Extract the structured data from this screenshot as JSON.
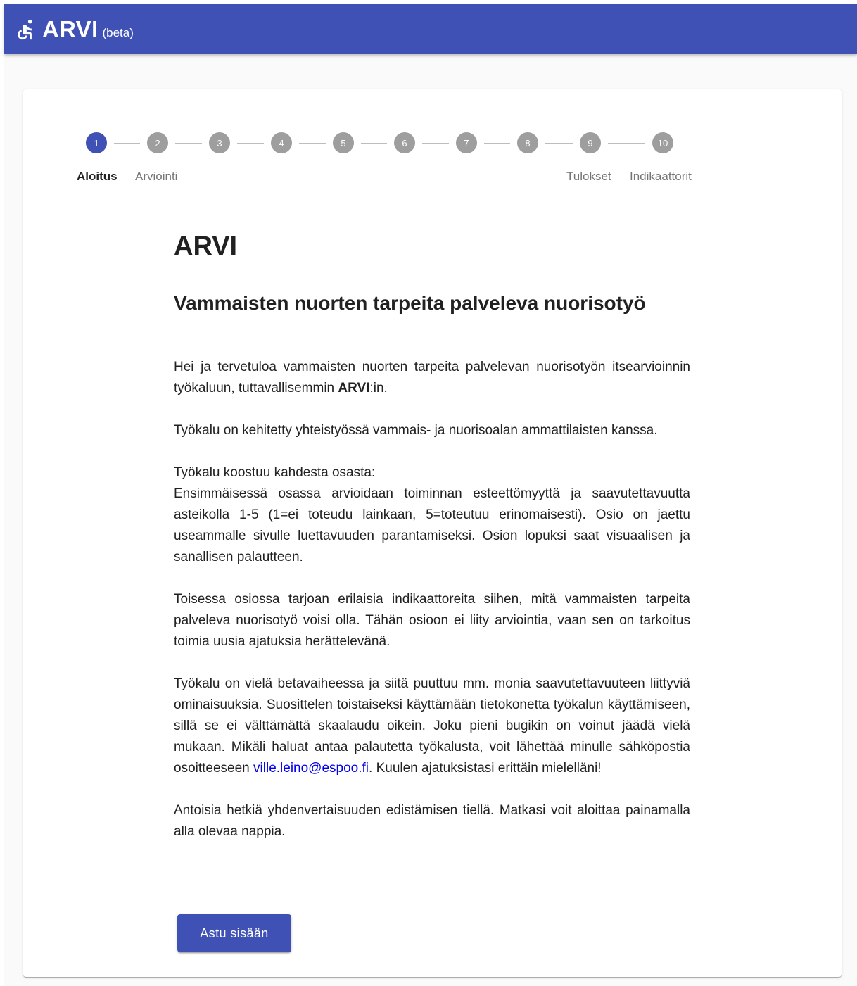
{
  "header": {
    "title": "ARVI",
    "beta": "(beta)",
    "logo_icon": "accessibility-icon",
    "color": "#3f51b5"
  },
  "stepper": {
    "steps": [
      "1",
      "2",
      "3",
      "4",
      "5",
      "6",
      "7",
      "8",
      "9",
      "10"
    ],
    "active_step": 1,
    "labels": {
      "step1": "Aloitus",
      "step2": "Arviointi",
      "step9": "Tulokset",
      "step10": "Indikaattorit"
    }
  },
  "main": {
    "title": "ARVI",
    "subtitle": "Vammaisten nuorten tarpeita palveleva nuorisotyö",
    "p1_before": "Hei ja tervetuloa vammaisten nuorten tarpeita palvelevan nuorisotyön itsearvioinnin työkaluun, tuttavallisemmin ",
    "p1_bold": "ARVI",
    "p1_after": ":in.",
    "p2": "Työkalu on kehitetty yhteistyössä vammais- ja nuorisoalan ammattilaisten kanssa.",
    "p3_line1": "Työkalu koostuu kahdesta osasta:",
    "p3_line2": "Ensimmäisessä osassa arvioidaan toiminnan esteettömyyttä ja saavutettavuutta asteikolla 1-5 (1=ei toteudu lainkaan, 5=toteutuu erinomaisesti). Osio on jaettu useammalle sivulle luettavuuden parantamiseksi. Osion lopuksi saat visuaalisen ja sanallisen palautteen.",
    "p4": "Toisessa osiossa tarjoan erilaisia indikaattoreita siihen, mitä vammaisten tarpeita palveleva nuorisotyö voisi olla. Tähän osioon ei liity arviointia, vaan sen on tarkoitus toimia uusia ajatuksia herättelevänä.",
    "p5_before": "Työkalu on vielä betavaiheessa ja siitä puuttuu mm. monia saavutettavuuteen liittyviä ominaisuuksia. Suosittelen toistaiseksi käyttämään tietokonetta työkalun käyttämiseen, sillä se ei välttämättä skaalaudu oikein. Joku pieni bugikin on voinut jäädä vielä mukaan. Mikäli haluat antaa palautetta työkalusta, voit lähettää minulle sähköpostia osoitteeseen ",
    "p5_link": "ville.leino@espoo.fi",
    "p5_after": ". Kuulen ajatuksistasi erittäin mielelläni!",
    "p6": "Antoisia hetkiä yhdenvertaisuuden edistämisen tiellä. Matkasi voit aloittaa painamalla alla olevaa nappia.",
    "button_label": "Astu sisään"
  }
}
